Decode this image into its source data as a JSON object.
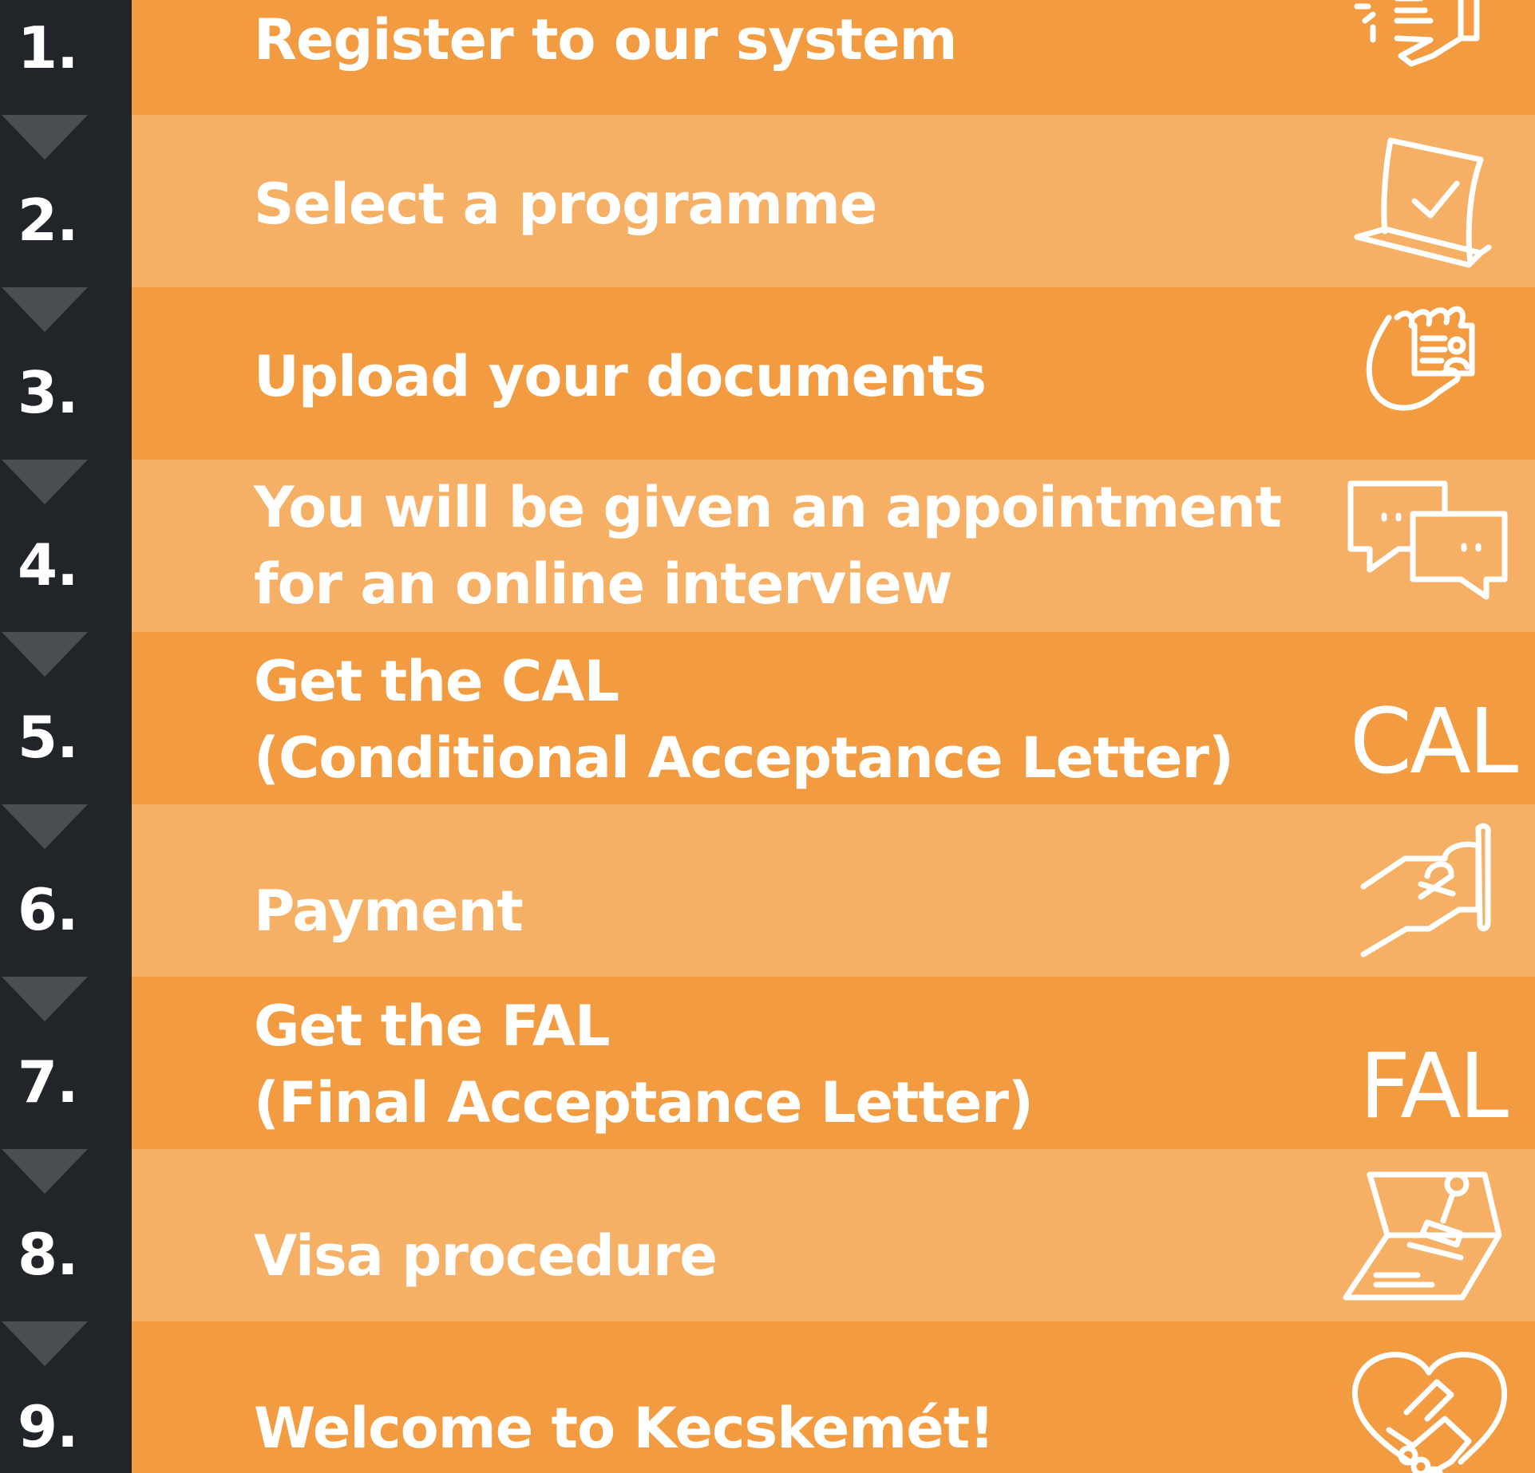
{
  "colors": {
    "sidebar": "#212529",
    "band_dark": "#f29b40",
    "band_light": "#f5b066",
    "arrow": "#4a4e53",
    "text": "#ffffff"
  },
  "steps": [
    {
      "number": "1.",
      "lines": [
        "Register to our system"
      ],
      "icon": "hand-tap-icon"
    },
    {
      "number": "2.",
      "lines": [
        "Select a programme"
      ],
      "icon": "laptop-check-icon"
    },
    {
      "number": "3.",
      "lines": [
        "Upload your documents"
      ],
      "icon": "hand-document-icon"
    },
    {
      "number": "4.",
      "lines": [
        "You will be given an appointment",
        "for an online interview"
      ],
      "icon": "chat-bubbles-icon"
    },
    {
      "number": "5.",
      "lines": [
        "Get the CAL",
        "(Conditional Acceptance Letter)"
      ],
      "icon_text": "CAL"
    },
    {
      "number": "6.",
      "lines": [
        "Payment"
      ],
      "icon": "hand-card-payment-icon"
    },
    {
      "number": "7.",
      "lines": [
        "Get the FAL",
        "(Final Acceptance Letter)"
      ],
      "icon_text": "FAL"
    },
    {
      "number": "8.",
      "lines": [
        "Visa procedure"
      ],
      "icon": "passport-stamp-icon"
    },
    {
      "number": "9.",
      "lines": [
        "Welcome to Kecskemét!"
      ],
      "icon": "heart-handshake-icon"
    }
  ]
}
